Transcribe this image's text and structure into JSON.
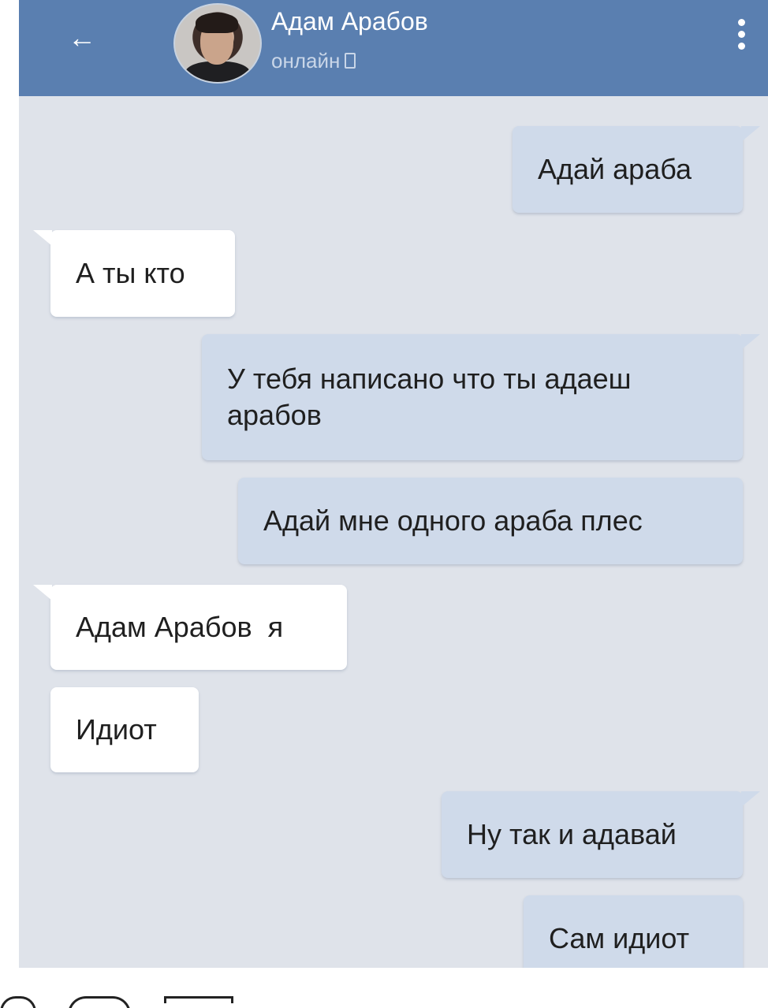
{
  "header": {
    "back_icon": "←",
    "contact_name": "Адам Арабов",
    "status": "онлайн",
    "menu_icon": "vertical-dots"
  },
  "messages": [
    {
      "direction": "out",
      "text": "Адай араба"
    },
    {
      "direction": "in",
      "text": "А ты кто"
    },
    {
      "direction": "out",
      "text": "У тебя написано что ты адаеш арабов"
    },
    {
      "direction": "out",
      "text": "Адай мне одного араба плес"
    },
    {
      "direction": "in",
      "text": "Адам Арабов  я"
    },
    {
      "direction": "in",
      "text": "Идиот"
    },
    {
      "direction": "out",
      "text": "Ну так и адавай"
    },
    {
      "direction": "out",
      "text": "Сам идиот"
    }
  ],
  "colors": {
    "header_bg": "#5a7fb0",
    "chat_bg": "#dfe3ea",
    "outgoing_bubble": "#cfdaea",
    "incoming_bubble": "#ffffff"
  }
}
